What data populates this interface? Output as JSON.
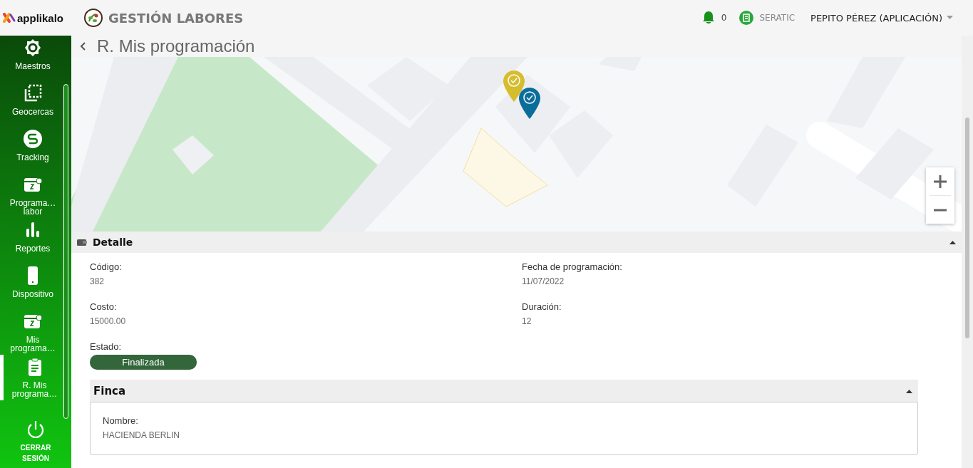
{
  "header": {
    "brand": "applikalo",
    "app_title": "GESTIÓN LABORES",
    "notifications": "0",
    "company": "SERATIC",
    "user": "PEPITO PÉREZ (APLICACIÓN)"
  },
  "sidebar": {
    "items": [
      {
        "label": [
          "Maestros"
        ],
        "selected": false
      },
      {
        "label": [
          "Geocercas"
        ],
        "selected": false
      },
      {
        "label": [
          "Tracking"
        ],
        "selected": false
      },
      {
        "label": [
          "Programa…",
          "labor"
        ],
        "selected": false
      },
      {
        "label": [
          "Reportes"
        ],
        "selected": false
      },
      {
        "label": [
          "Dispositivo"
        ],
        "selected": false
      },
      {
        "label": [
          "Mis",
          "programa…"
        ],
        "selected": false
      },
      {
        "label": [
          "R. Mis",
          "programa…"
        ],
        "selected": true
      }
    ],
    "logout": [
      "CERRAR",
      "SESIÓN"
    ]
  },
  "page": {
    "title": "R. Mis programación"
  },
  "map": {
    "kind": "picture",
    "pins": [
      {
        "color": "#d6bd2e"
      },
      {
        "color": "#0b6d9a"
      }
    ]
  },
  "detail": {
    "title": "Detalle",
    "expanded": true,
    "fields": [
      {
        "label": "Código:",
        "value": "382"
      },
      {
        "label": "Fecha de programación:",
        "value": "11/07/2022"
      },
      {
        "label": "Costo:",
        "value": "15000.00"
      },
      {
        "label": "Duración:",
        "value": "12"
      }
    ],
    "status": {
      "label": "Estado:",
      "value": "Finalizada"
    }
  },
  "finca": {
    "title": "Finca",
    "expanded": true,
    "fields": [
      {
        "label": "Nombre:",
        "value": "HACIENDA BERLIN"
      }
    ]
  }
}
